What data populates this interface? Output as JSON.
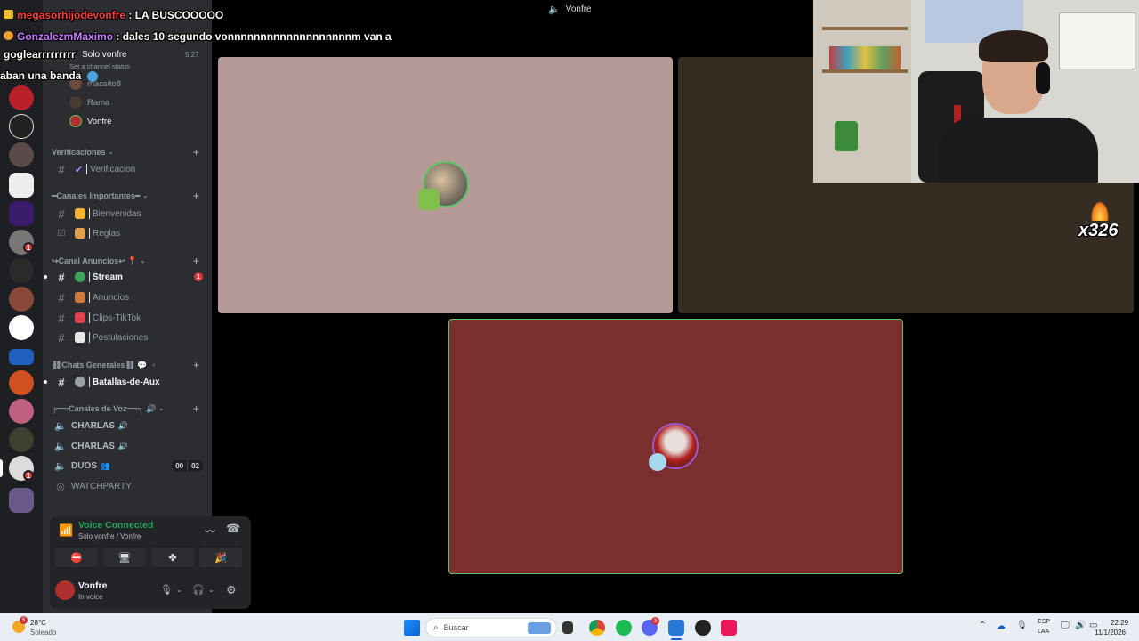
{
  "window": {
    "title": "Vonfre"
  },
  "chat": [
    {
      "user": "megasorhijodevonfre",
      "user_color": "#ff3b3b",
      "sep": " : ",
      "text": "LA BUSCOOOOO"
    },
    {
      "user": "GonzalezmMaximo",
      "user_color": "#c77dff",
      "sep": " : ",
      "text": "dales 10 segundo vonnnnnnnnnnnnnnnnnnnm van a"
    },
    {
      "text": "goglearrrrrrrrr"
    },
    {
      "text": "aban una banda"
    }
  ],
  "voice_header": {
    "channel_title": "Solo vonfre",
    "channel_status": "Set a channel status",
    "timer": "5:27"
  },
  "voice_members": [
    {
      "name": "macsito8",
      "avatar_color": "#6b4b3e"
    },
    {
      "name": "Rama",
      "avatar_color": "#4a3a30"
    },
    {
      "name": "Vonfre",
      "avatar_color": "#b03030",
      "active": true
    }
  ],
  "categories": {
    "verificaciones": "Verificaciones",
    "importantes": "━Canales Importantes━",
    "anuncios": "↪Canal Anuncios↩ 📍",
    "generales": "⛓Chats Generales⛓ 💬",
    "voz": "╒══Canales de Voz══╕ 🔊"
  },
  "channels": {
    "verificacion": "Verificacion",
    "bienvenidas": "Bienvenidas",
    "reglas": "Reglas",
    "stream": "Stream",
    "stream_badge": "1",
    "anuncios": "Anuncios",
    "clips": "Clips-TikTok",
    "postulaciones": "Postulaciones",
    "batallas": "Batallas-de-Aux"
  },
  "voice_channels": {
    "charlas1": "CHARLAS",
    "charlas2": "CHARLAS",
    "duos": "DUOS",
    "duos_count_a": "00",
    "duos_count_b": "02",
    "watchparty": "WATCHPARTY"
  },
  "voice_panel": {
    "connected": "Voice Connected",
    "location": "Solo vonfre / Vonfre",
    "username": "Vonfre",
    "status": "In voice"
  },
  "stream_overlay": {
    "combo": "x326"
  },
  "taskbar": {
    "weather_temp": "28°C",
    "weather_desc": "Soleado",
    "weather_badge": "5",
    "search_placeholder": "Buscar",
    "discord_badge": "3",
    "lang_top": "ESP",
    "lang_bottom": "LAA",
    "time": "22:29",
    "date": "11/1/2026"
  },
  "colors": {
    "tile_left": "#b59a98",
    "tile_right": "#352c22",
    "tile_bottom": "#7b2e2e",
    "speaking_border": "#5ec46a"
  }
}
